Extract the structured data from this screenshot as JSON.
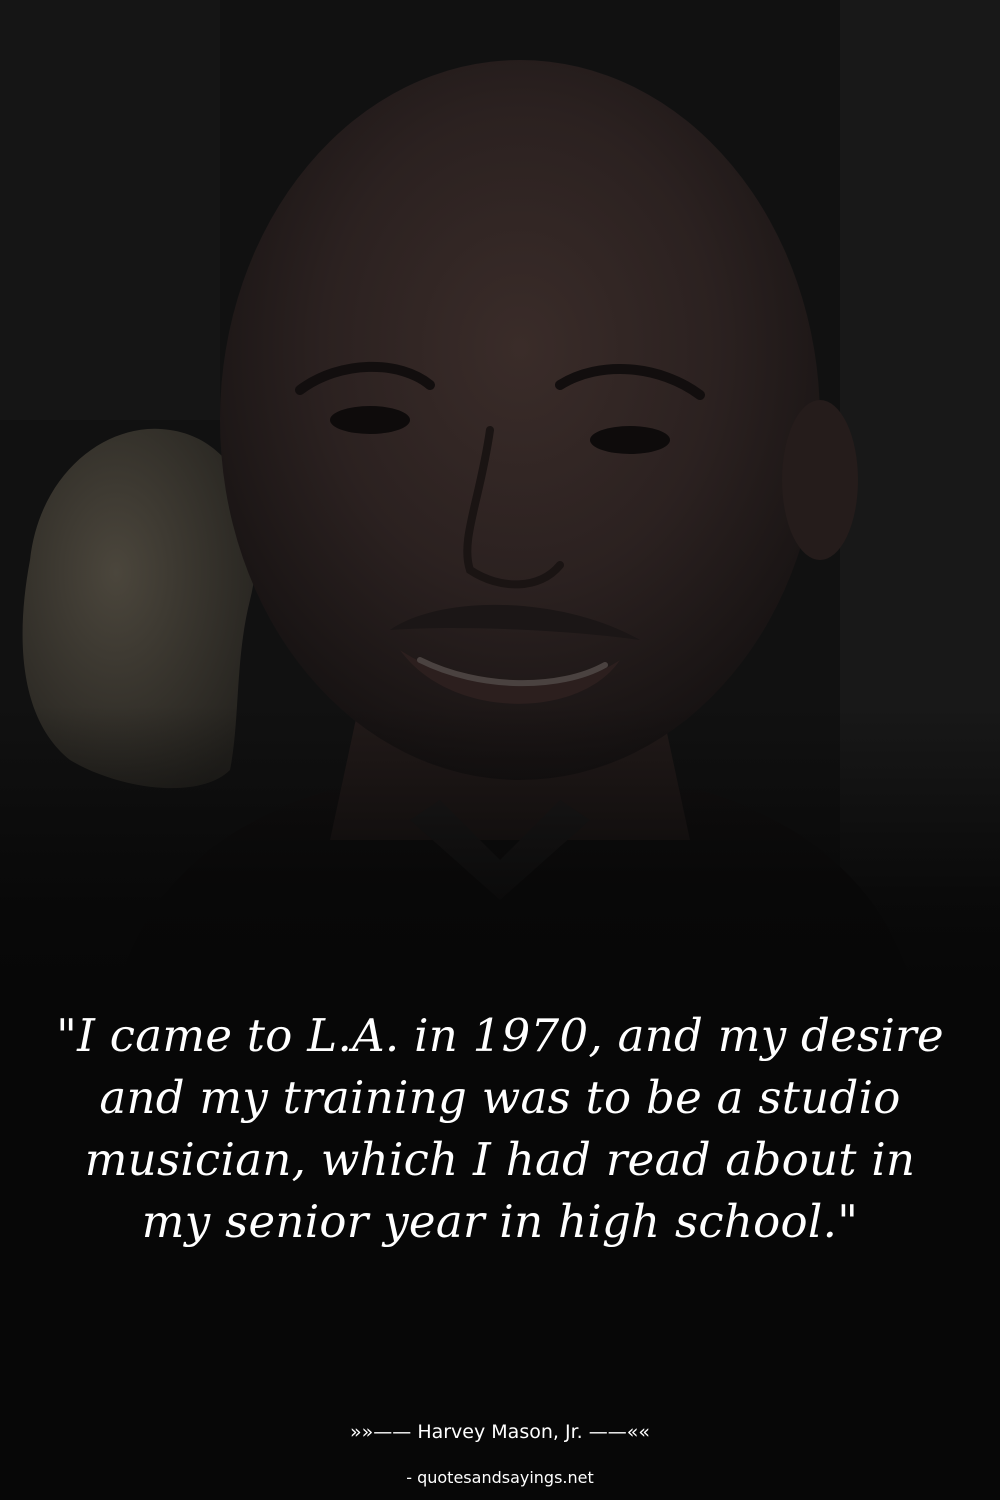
{
  "quote": {
    "text": "\"I came to L.A. in 1970, and my desire and my training was to be a studio musician, which I had read about in my senior year in high school.\""
  },
  "attribution": {
    "text": "»»—— Harvey Mason, Jr. ——««"
  },
  "source": {
    "text": "- quotesandsayings.net"
  },
  "colors": {
    "background": "#070707",
    "text": "#ffffff"
  }
}
